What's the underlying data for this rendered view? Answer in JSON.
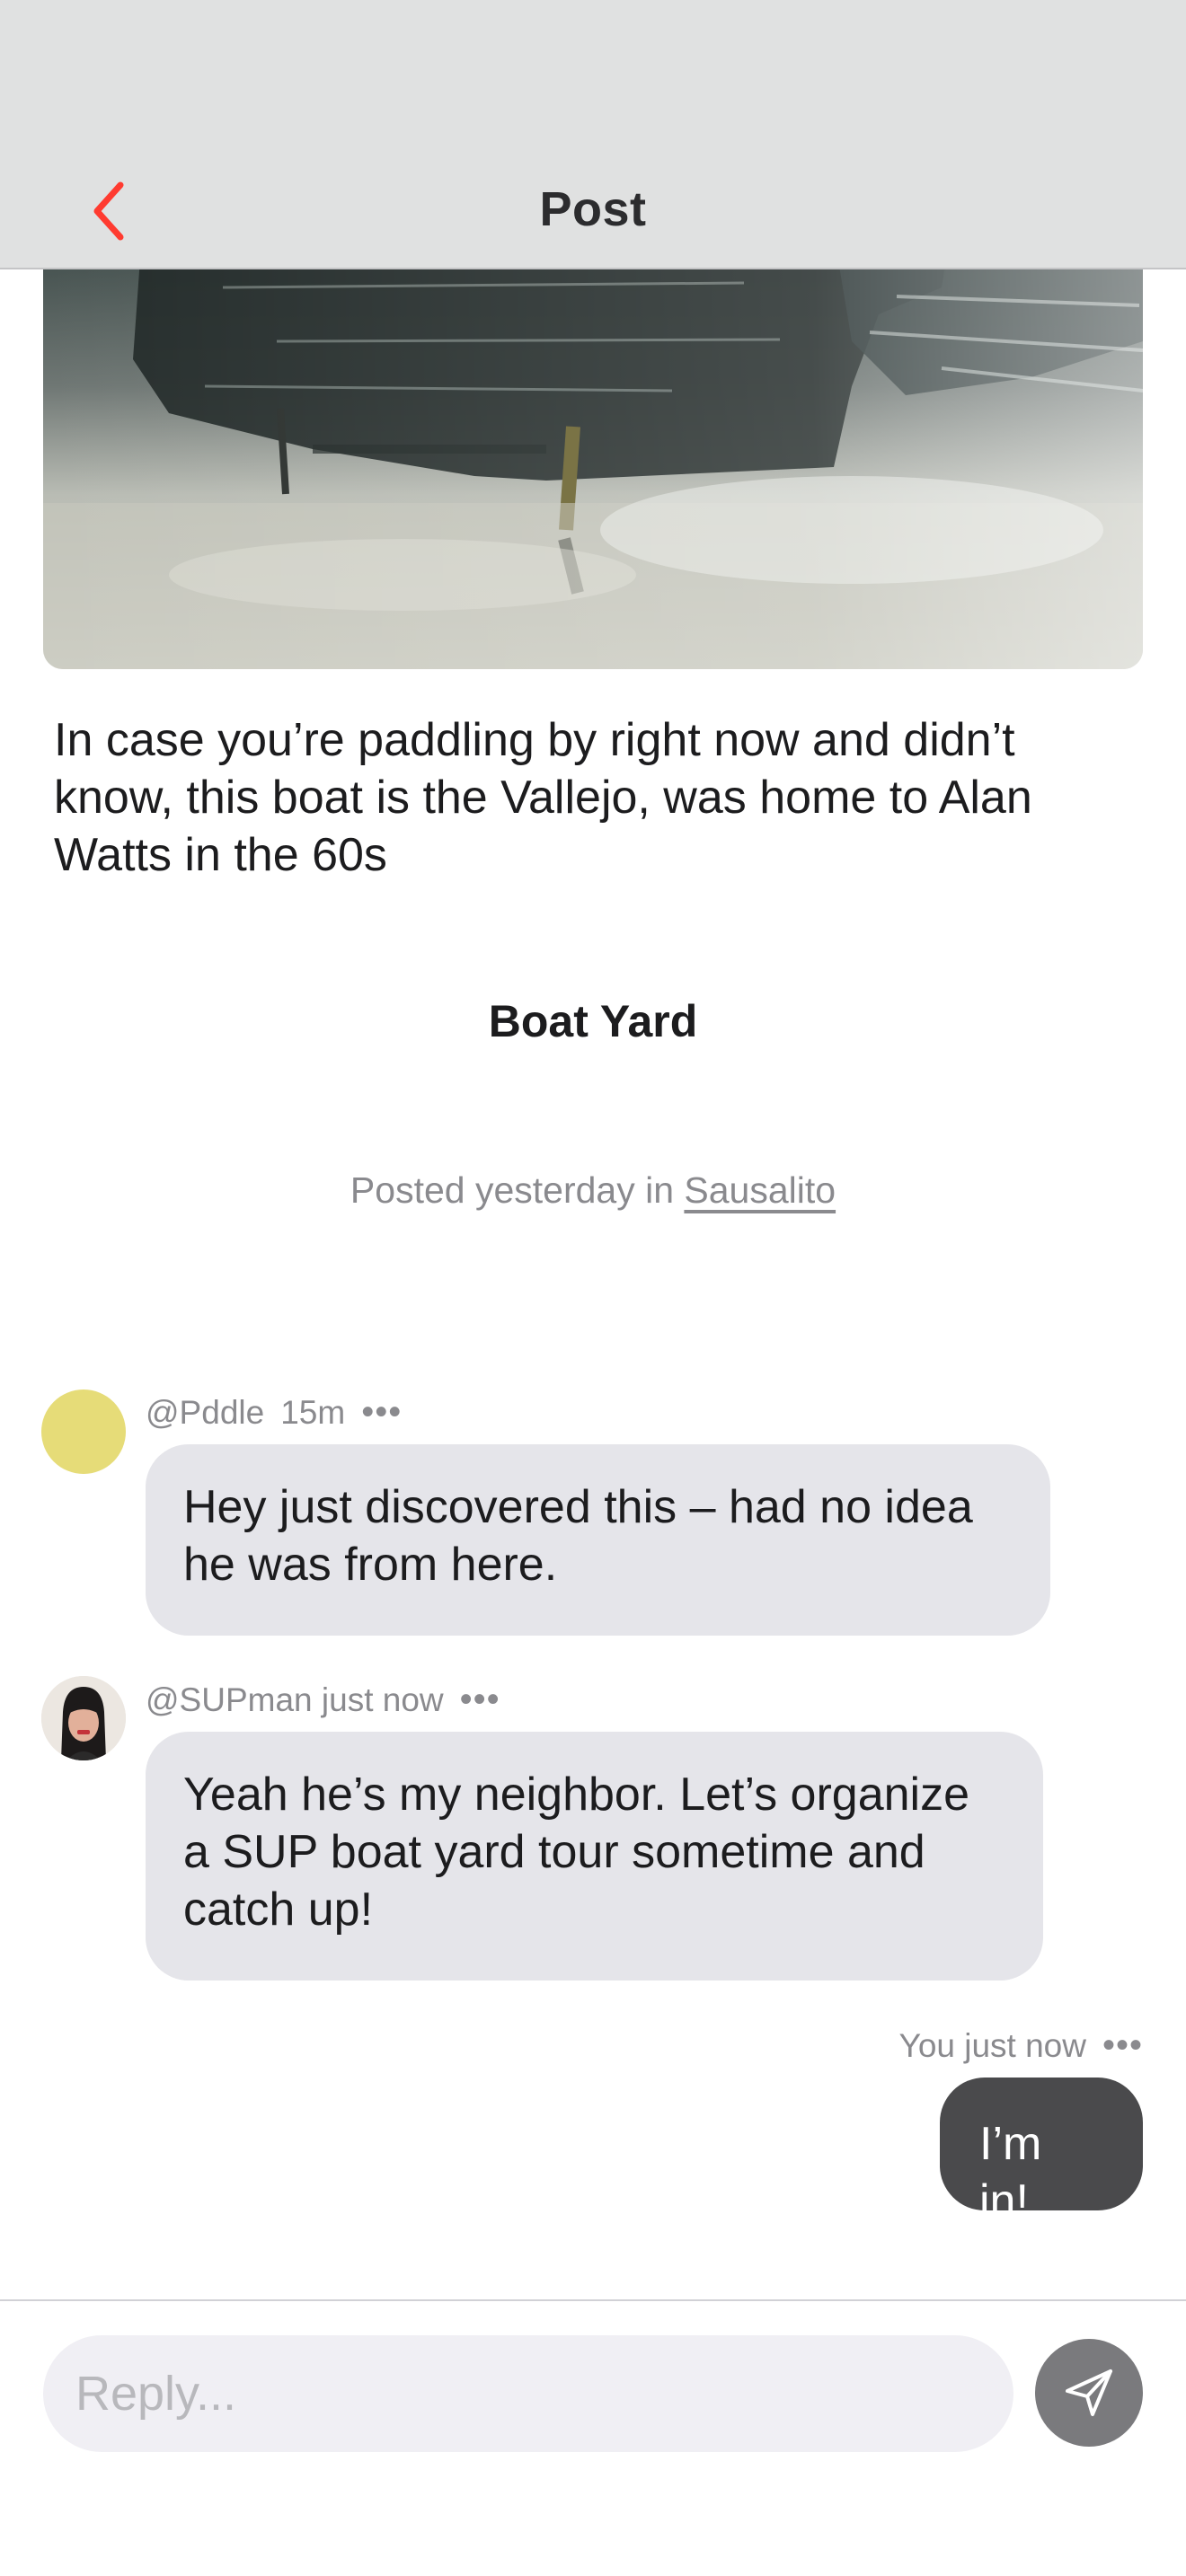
{
  "header": {
    "title": "Post",
    "back_icon": "chevron-left-icon",
    "accent_color": "#ff3b30"
  },
  "post": {
    "caption": "In case you’re paddling by right now and didn’t know, this boat is the Vallejo, was home to Alan Watts in the 60s",
    "location_name": "Boat Yard",
    "meta_prefix": "Posted yesterday in ",
    "meta_place": "Sausalito"
  },
  "comments": [
    {
      "handle": "@Pddle",
      "time": "15m",
      "more": "•••",
      "text": "Hey just discovered this – had no idea he was from here.",
      "avatar_color": "#e6dc78"
    },
    {
      "handle": "@SUPman",
      "time": "just now",
      "more": "•••",
      "text": "Yeah he’s my neighbor. Let’s organize a SUP boat yard tour sometime and catch up!"
    },
    {
      "handle": "You",
      "time": "just now",
      "more": "•••",
      "text": "I’m in!"
    }
  ],
  "reply": {
    "placeholder": "Reply...",
    "send_icon": "send-icon"
  }
}
